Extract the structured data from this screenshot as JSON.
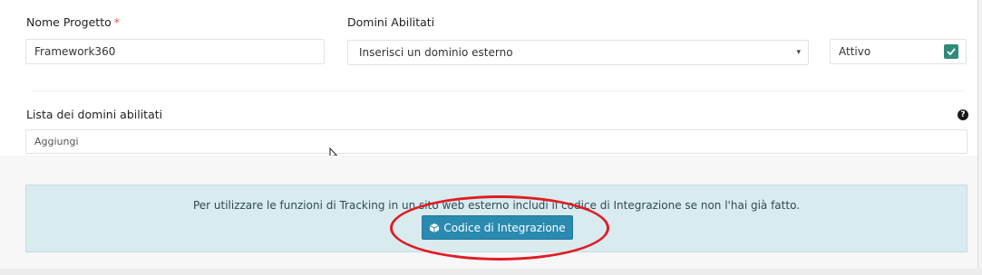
{
  "project": {
    "name_label": "Nome Progetto",
    "required_mark": "*",
    "name_value": "Framework360"
  },
  "domains": {
    "label": "Domini Abilitati",
    "select_value": "Inserisci un dominio esterno",
    "select_caret": "▾",
    "active_label": "Attivo",
    "active_checked": true
  },
  "domain_list": {
    "label": "Lista dei domini abilitati",
    "help_icon": "?",
    "input_placeholder": "Aggiungi"
  },
  "integration": {
    "info_text": "Per utilizzare le funzioni di Tracking in un sito web esterno includi il codice di Integrazione se non l'hai già fatto.",
    "button_label": "Codice di Integrazione",
    "button_icon": "cube-icon"
  },
  "colors": {
    "checkbox": "#2e8b7a",
    "info_bg": "#d9ebef",
    "button": "#2a8ab0",
    "annotation": "#e01c24",
    "required": "#d9534f"
  }
}
